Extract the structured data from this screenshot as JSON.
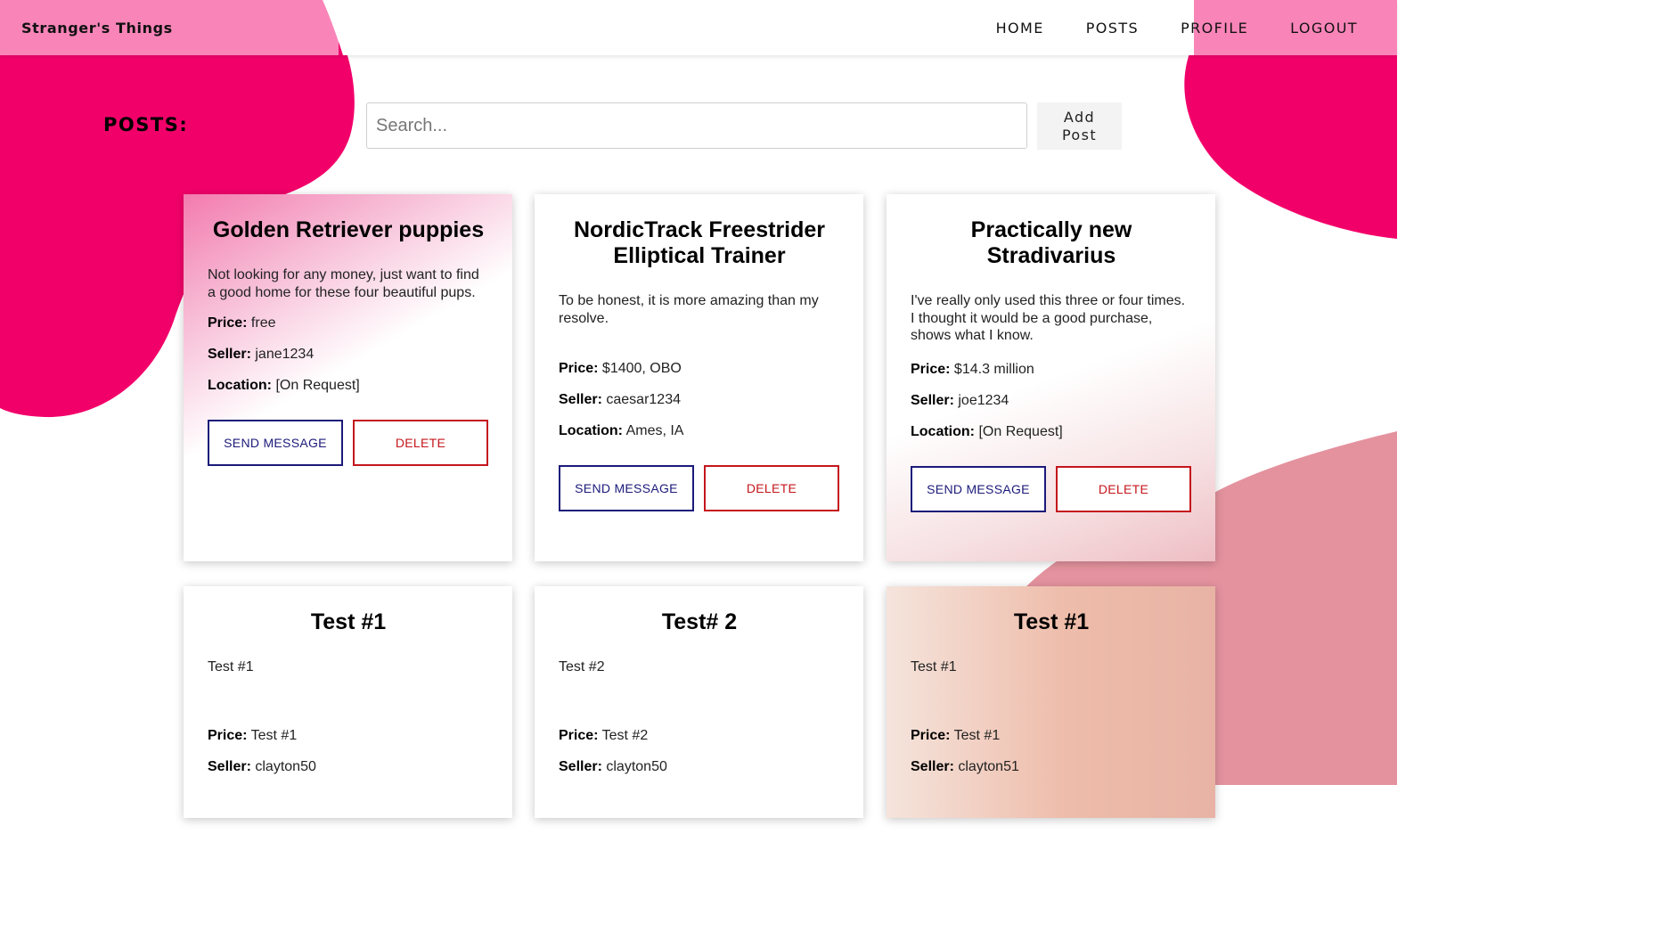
{
  "header": {
    "brand": "Stranger's Things",
    "nav": [
      "HOME",
      "POSTS",
      "PROFILE",
      "LOGOUT"
    ]
  },
  "toolbar": {
    "title": "POSTS:",
    "search_placeholder": "Search...",
    "add_label": "Add Post"
  },
  "labels": {
    "price": "Price:",
    "seller": "Seller:",
    "location": "Location:",
    "send_message": "SEND MESSAGE",
    "delete": "DELETE"
  },
  "posts": [
    {
      "title": "Golden Retriever puppies",
      "description": "Not looking for any money, just want to find a good home for these four beautiful pups.",
      "price": "free",
      "seller": "jane1234",
      "location": "[On Request]"
    },
    {
      "title": "NordicTrack Freestrider Elliptical Trainer",
      "description": "To be honest, it is more amazing than my resolve.",
      "price": "$1400, OBO",
      "seller": "caesar1234",
      "location": "Ames, IA"
    },
    {
      "title": "Practically new Stradivarius",
      "description": "I've really only used this three or four times. I thought it would be a good purchase, shows what I know.",
      "price": "$14.3 million",
      "seller": "joe1234",
      "location": "[On Request]"
    },
    {
      "title": "Test #1",
      "description": "Test #1",
      "price": "Test #1",
      "seller": "clayton50"
    },
    {
      "title": "Test# 2",
      "description": "Test #2",
      "price": "Test #2",
      "seller": "clayton50"
    },
    {
      "title": "Test #1",
      "description": "Test #1",
      "price": "Test #1",
      "seller": "clayton51"
    }
  ],
  "colors": {
    "accent_pink": "#f2006a",
    "header_pink": "#f985b8",
    "message_border": "#1b1a7a",
    "delete_border": "#c4161c"
  }
}
